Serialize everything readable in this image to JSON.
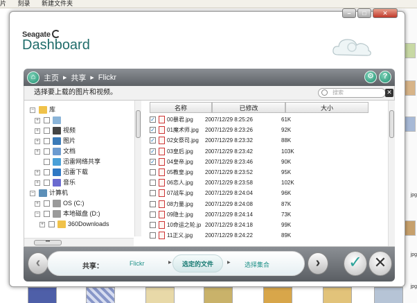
{
  "background": {
    "menu": [
      "片",
      "刻录",
      "新建文件夹"
    ],
    "side_labels": [
      "jpg",
      "jpg",
      "jpg"
    ]
  },
  "colors": {
    "accent": "#1f8f70",
    "brand_text": "#1f6c6a",
    "step_text": "#1f9188"
  },
  "window": {
    "controls": [
      "minimize",
      "maximize",
      "close"
    ]
  },
  "brand": {
    "seagate": "Seagate",
    "dashboard": "Dashboard"
  },
  "breadcrumb": {
    "items": [
      "主页",
      "共享",
      "Flickr"
    ]
  },
  "header_icons": [
    "gear-icon",
    "help-icon"
  ],
  "instruction": "选择要上载的图片和视频。",
  "search": {
    "placeholder": "搜索"
  },
  "tree": [
    {
      "label": "库",
      "icon": "library-icon",
      "expand": "−",
      "checkbox": false,
      "level": 0
    },
    {
      "label": "",
      "icon": "file-icon",
      "expand": "+",
      "checkbox": true,
      "level": 1
    },
    {
      "label": "视频",
      "icon": "video-icon",
      "expand": "+",
      "checkbox": true,
      "level": 1
    },
    {
      "label": "图片",
      "icon": "picture-icon",
      "expand": "+",
      "checkbox": true,
      "level": 1
    },
    {
      "label": "文档",
      "icon": "document-icon",
      "expand": "+",
      "checkbox": true,
      "level": 1
    },
    {
      "label": "迅雷网络共享",
      "icon": "share-icon",
      "expand": "",
      "checkbox": true,
      "level": 1
    },
    {
      "label": "迅雷下载",
      "icon": "download-icon",
      "expand": "+",
      "checkbox": true,
      "level": 1
    },
    {
      "label": "音乐",
      "icon": "music-icon",
      "expand": "+",
      "checkbox": true,
      "level": 1
    },
    {
      "label": "计算机",
      "icon": "computer-icon",
      "expand": "−",
      "checkbox": false,
      "level": 0
    },
    {
      "label": "OS (C:)",
      "icon": "drive-icon",
      "expand": "+",
      "checkbox": true,
      "level": 1
    },
    {
      "label": "本地磁盘 (D:)",
      "icon": "drive-icon",
      "expand": "−",
      "checkbox": true,
      "level": 1
    },
    {
      "label": "360Downloads",
      "icon": "folder-icon",
      "expand": "+",
      "checkbox": true,
      "level": 2
    }
  ],
  "file_columns": [
    "名称",
    "已修改",
    "大小"
  ],
  "files": [
    {
      "name": "00暴君.jpg",
      "modified": "2007/12/29 8:25:26",
      "size": "61K",
      "checked": true
    },
    {
      "name": "01魔术师.jpg",
      "modified": "2007/12/29 8:23:26",
      "size": "92K",
      "checked": true
    },
    {
      "name": "02女祭司.jpg",
      "modified": "2007/12/29 8:23:32",
      "size": "88K",
      "checked": true
    },
    {
      "name": "03皇后.jpg",
      "modified": "2007/12/29 8:23:42",
      "size": "103K",
      "checked": true
    },
    {
      "name": "04皇帝.jpg",
      "modified": "2007/12/29 8:23:46",
      "size": "90K",
      "checked": true
    },
    {
      "name": "05教皇.jpg",
      "modified": "2007/12/29 8:23:52",
      "size": "95K",
      "checked": false
    },
    {
      "name": "06恋人.jpg",
      "modified": "2007/12/29 8:23:58",
      "size": "102K",
      "checked": false
    },
    {
      "name": "07战车.jpg",
      "modified": "2007/12/29 8:24:04",
      "size": "96K",
      "checked": false
    },
    {
      "name": "08力量.jpg",
      "modified": "2007/12/29 8:24:08",
      "size": "87K",
      "checked": false
    },
    {
      "name": "09隐士.jpg",
      "modified": "2007/12/29 8:24:14",
      "size": "73K",
      "checked": false
    },
    {
      "name": "10命运之轮.jp",
      "modified": "2007/12/29 8:24:18",
      "size": "99K",
      "checked": false
    },
    {
      "name": "11正义.jpg",
      "modified": "2007/12/29 8:24:22",
      "size": "89K",
      "checked": false
    }
  ],
  "wizard": {
    "label": "共享：",
    "steps": [
      "Flickr",
      "选定的文件",
      "选择集合"
    ],
    "active_step": 1
  }
}
